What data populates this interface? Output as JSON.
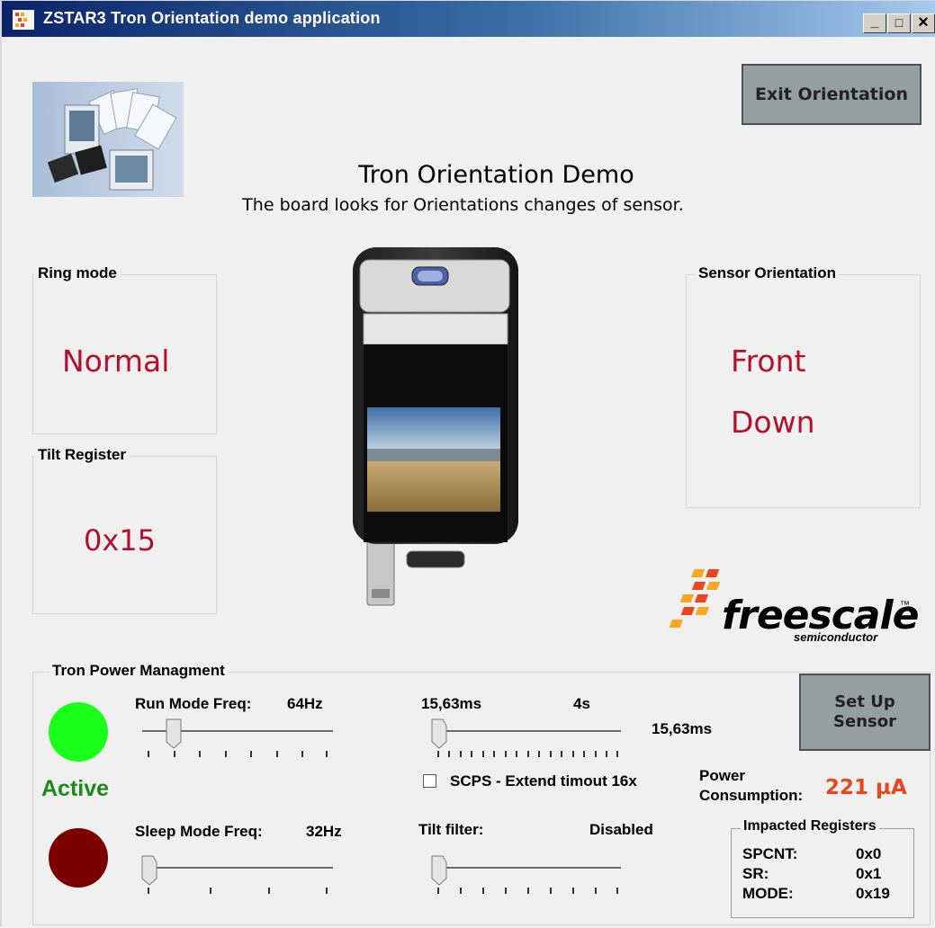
{
  "window": {
    "title": "ZSTAR3 Tron Orientation demo application",
    "controls": {
      "minimize": "_",
      "maximize": "□",
      "close": "×"
    }
  },
  "header": {
    "title": "Tron Orientation Demo",
    "subtitle": "The board looks for Orientations changes of sensor.",
    "exit_button": "Exit Orientation"
  },
  "ring_mode": {
    "label": "Ring mode",
    "value": "Normal"
  },
  "tilt_register": {
    "label": "Tilt Register",
    "value": "0x15"
  },
  "sensor_orientation": {
    "label": "Sensor Orientation",
    "line1": "Front",
    "line2": "Down"
  },
  "logo": {
    "brand": "freescale",
    "tm": "™",
    "sub": "semiconductor"
  },
  "power": {
    "label": "Tron Power Managment",
    "status": "Active",
    "run_mode_label": "Run Mode Freq:",
    "run_mode_value": "64Hz",
    "sleep_mode_label": "Sleep Mode Freq:",
    "sleep_mode_value": "32Hz",
    "timeout_min": "15,63ms",
    "timeout_max": "4s",
    "timeout_value": "15,63ms",
    "scps_label": "SCPS - Extend timout 16x",
    "scps_checked": false,
    "tilt_filter_label": "Tilt filter:",
    "tilt_filter_value": "Disabled",
    "setup_button": "Set Up Sensor",
    "consumption_label_1": "Power",
    "consumption_label_2": "Consumption:",
    "consumption_value": "221 µA",
    "run_slider_position": 0.17,
    "sleep_slider_position": 0.0,
    "timeout_slider_position": 0.0,
    "tilt_slider_position": 0.0
  },
  "registers": {
    "label": "Impacted Registers",
    "rows": [
      {
        "name": "SPCNT:",
        "value": "0x0"
      },
      {
        "name": "SR:",
        "value": "0x1"
      },
      {
        "name": "MODE:",
        "value": "0x19"
      }
    ]
  },
  "colors": {
    "accent_red": "#b4102c",
    "active_green": "#1aff1a",
    "sleep_red": "#7a0000",
    "status_green": "#1a8a1a",
    "consumption_orange": "#e8461e"
  }
}
